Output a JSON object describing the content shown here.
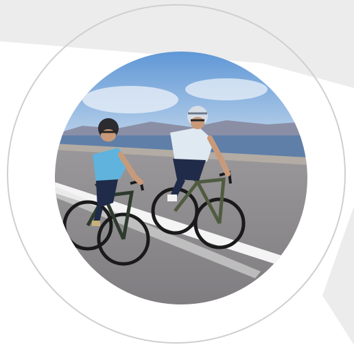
{
  "scene": {
    "subject": "cyclists-photo",
    "colors": {
      "background": "#ffffff",
      "panel_gray": "#ececec",
      "ring": "#cfcfcf",
      "sky_top": "#5f97d6",
      "sky_bottom": "#b9d2ea",
      "sea": "#5f7fa8",
      "mountains": "#8a8fa6",
      "road": "#8c8a8c",
      "road_line": "#f4f4f4",
      "jersey_left": "#5fb3dd",
      "jersey_right": "#dfe9f2",
      "shorts": "#1f2b48"
    }
  }
}
